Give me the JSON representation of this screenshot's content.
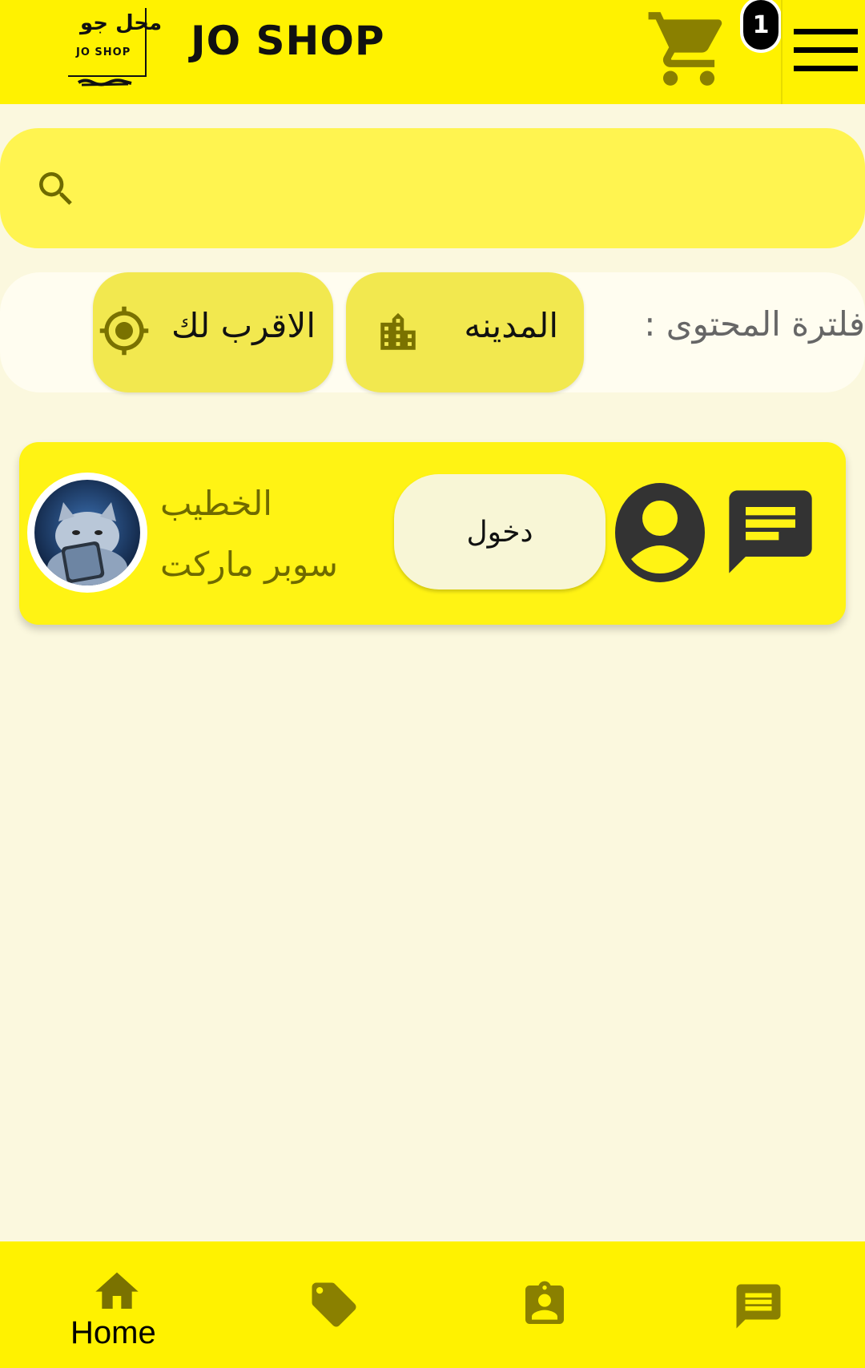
{
  "header": {
    "logo_arabic": "محل جو",
    "logo_english": "JO SHOP",
    "brand_title": "JO SHOP",
    "cart_icon": "shopping-cart-icon",
    "cart_count": "1",
    "menu_icon": "hamburger-menu-icon"
  },
  "search": {
    "icon": "search-icon",
    "value": "",
    "placeholder": ""
  },
  "filter": {
    "label": "فلترة المحتوى :",
    "chips": [
      {
        "label": "المدينه",
        "icon": "city-building-icon"
      },
      {
        "label": "الاقرب لك",
        "icon": "gps-location-icon"
      }
    ]
  },
  "stores": [
    {
      "name": "الخطيب",
      "type": "سوبر ماركت",
      "avatar": "store-avatar-cat",
      "enter_label": "دخول",
      "profile_icon": "account-circle-icon",
      "chat_icon": "chat-message-icon"
    }
  ],
  "bottom_nav": [
    {
      "label": "Home",
      "icon": "home-icon",
      "active": true
    },
    {
      "label": "",
      "icon": "tag-icon",
      "active": false
    },
    {
      "label": "",
      "icon": "contact-badge-icon",
      "active": false
    },
    {
      "label": "",
      "icon": "chat-message-icon",
      "active": false
    }
  ],
  "colors": {
    "header_bg": "#fff200",
    "page_bg": "#fbf8de",
    "search_bg": "#fff450",
    "chip_bg": "#f2e84f",
    "icon_olive": "#8a8000",
    "card_bg": "#fff314"
  }
}
